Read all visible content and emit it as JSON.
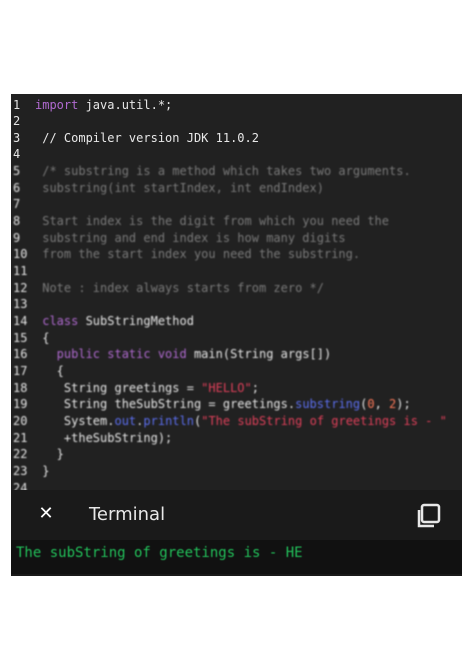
{
  "editor": {
    "lines": [
      {
        "n": "1",
        "parts": [
          {
            "c": "kw",
            "t": "import "
          },
          {
            "c": "plain",
            "t": "java.util.*;"
          }
        ]
      },
      {
        "n": "2",
        "parts": []
      },
      {
        "n": "3",
        "parts": [
          {
            "c": "plain",
            "t": " // Compiler version JDK 11.0.2"
          }
        ]
      },
      {
        "n": "4",
        "parts": []
      },
      {
        "n": "5",
        "parts": [
          {
            "c": "cm",
            "t": " /* substring is a method which takes two arguments."
          }
        ]
      },
      {
        "n": "6",
        "parts": [
          {
            "c": "cm",
            "t": " substring(int startIndex, int endIndex)"
          }
        ]
      },
      {
        "n": "7",
        "parts": []
      },
      {
        "n": "8",
        "parts": [
          {
            "c": "cm",
            "t": " Start index is the digit from which you need the"
          }
        ]
      },
      {
        "n": "9",
        "parts": [
          {
            "c": "cm",
            "t": " substring and end index is how many digits"
          }
        ]
      },
      {
        "n": "10",
        "parts": [
          {
            "c": "cm",
            "t": " from the start index you need the substring."
          }
        ]
      },
      {
        "n": "11",
        "parts": []
      },
      {
        "n": "12",
        "parts": [
          {
            "c": "cm",
            "t": " Note : index always starts from zero */"
          }
        ]
      },
      {
        "n": "13",
        "parts": []
      },
      {
        "n": "14",
        "parts": [
          {
            "c": "kw",
            "t": " class "
          },
          {
            "c": "plain",
            "t": "SubStringMethod"
          }
        ]
      },
      {
        "n": "15",
        "parts": [
          {
            "c": "plain",
            "t": " {"
          }
        ]
      },
      {
        "n": "16",
        "parts": [
          {
            "c": "kw",
            "t": "   public static void "
          },
          {
            "c": "plain",
            "t": "main(String args[])"
          }
        ]
      },
      {
        "n": "17",
        "parts": [
          {
            "c": "plain",
            "t": "   {"
          }
        ]
      },
      {
        "n": "18",
        "parts": [
          {
            "c": "plain",
            "t": "    String greetings = "
          },
          {
            "c": "str",
            "t": "\"HELLO\""
          },
          {
            "c": "plain",
            "t": ";"
          }
        ]
      },
      {
        "n": "19",
        "parts": [
          {
            "c": "plain",
            "t": "    String theSubString = greetings."
          },
          {
            "c": "method",
            "t": "substring"
          },
          {
            "c": "plain",
            "t": "("
          },
          {
            "c": "num",
            "t": "0"
          },
          {
            "c": "plain",
            "t": ", "
          },
          {
            "c": "num",
            "t": "2"
          },
          {
            "c": "plain",
            "t": ");"
          }
        ]
      },
      {
        "n": "20",
        "parts": [
          {
            "c": "plain",
            "t": "    System."
          },
          {
            "c": "field",
            "t": "out"
          },
          {
            "c": "plain",
            "t": "."
          },
          {
            "c": "method",
            "t": "println"
          },
          {
            "c": "plain",
            "t": "("
          },
          {
            "c": "str",
            "t": "\"The subString of greetings is - \""
          }
        ]
      },
      {
        "n": "21",
        "parts": [
          {
            "c": "plain",
            "t": "    +theSubString);"
          }
        ]
      },
      {
        "n": "22",
        "parts": [
          {
            "c": "plain",
            "t": "   }"
          }
        ]
      },
      {
        "n": "23",
        "parts": [
          {
            "c": "plain",
            "t": " }"
          }
        ]
      },
      {
        "n": "24",
        "parts": []
      }
    ]
  },
  "terminal": {
    "close_icon": "close-icon",
    "title": "Terminal",
    "copy_icon": "copy-icon",
    "output": "The subString of greetings is - HE"
  },
  "colors": {
    "editor_bg": "#212121",
    "keyword": "#b06ad0",
    "string": "#e0405a",
    "output": "#22c05a"
  }
}
